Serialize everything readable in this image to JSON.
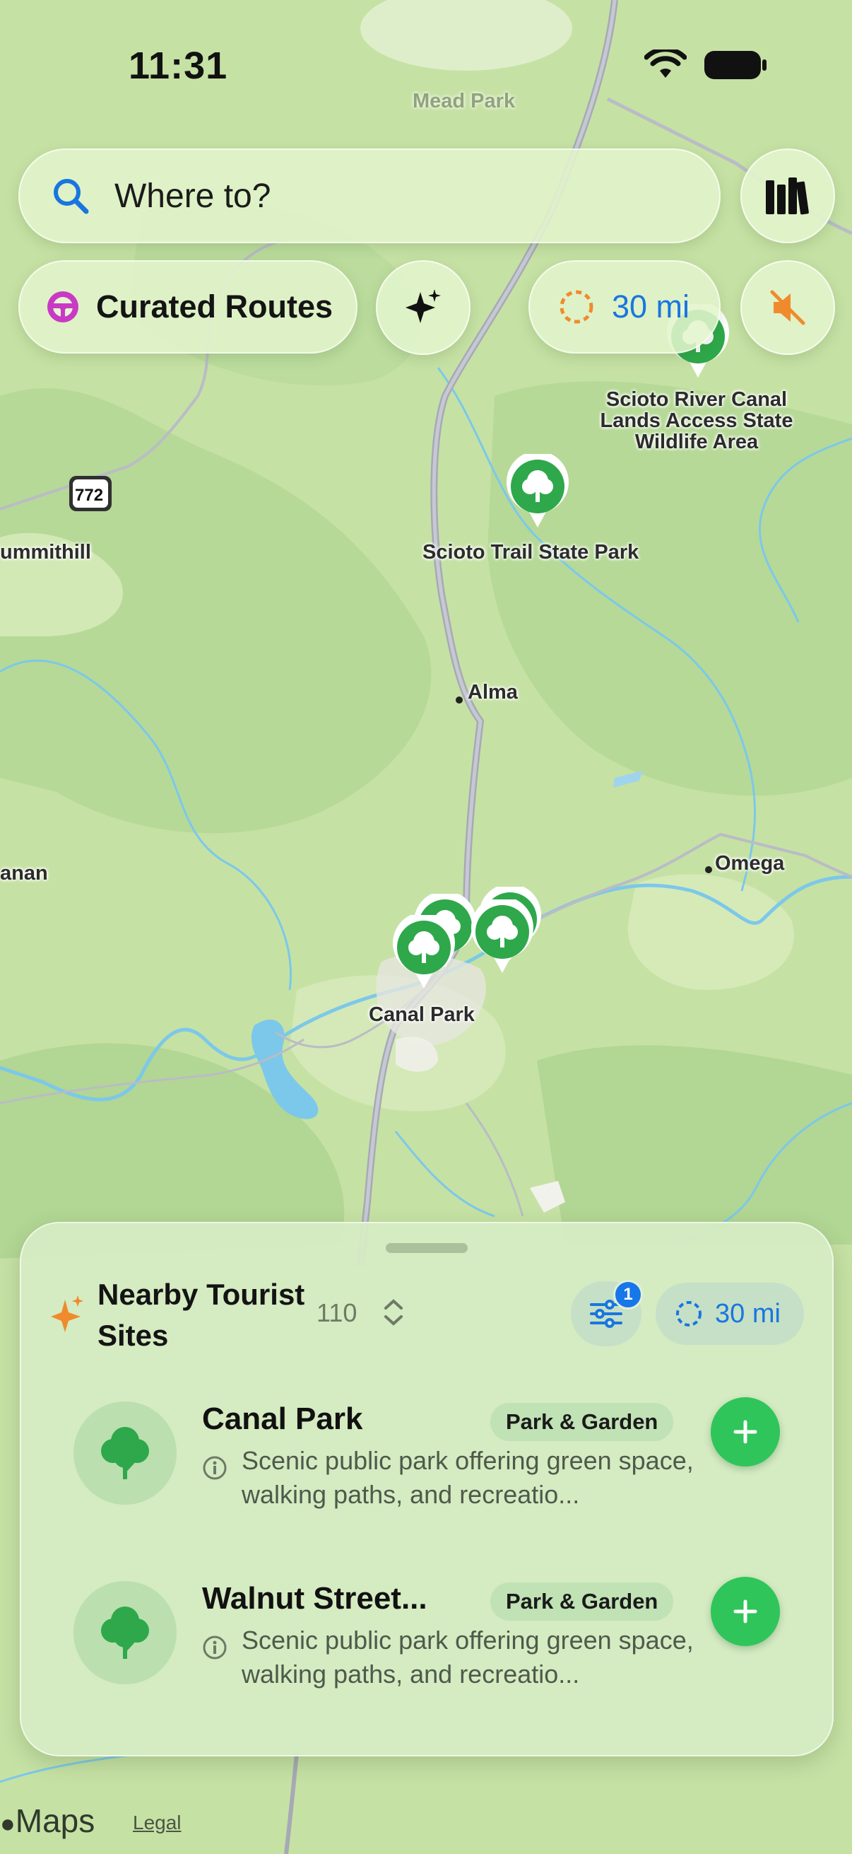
{
  "status_bar": {
    "time": "11:31"
  },
  "search": {
    "placeholder": "Where to?"
  },
  "toolbar": {
    "curated_routes_label": "Curated Routes",
    "distance_label": "30 mi"
  },
  "map": {
    "labels": {
      "scioto_canal": "Scioto River Canal Lands Access State Wildlife Area",
      "scioto_trail": "Scioto Trail State Park",
      "alma": "Alma",
      "omega": "Omega",
      "canal_park": "Canal Park",
      "summithill": "ummithill",
      "anan": "anan",
      "mead_park": "Mead Park",
      "route_number": "772"
    }
  },
  "sheet": {
    "title": "Nearby Tourist Sites",
    "count": "110",
    "filter_badge": "1",
    "distance_label": "30 mi",
    "items": [
      {
        "title": "Canal Park",
        "category": "Park & Garden",
        "description": "Scenic public park offering green space, walking paths, and recreatio..."
      },
      {
        "title": "Walnut Street...",
        "category": "Park & Garden",
        "description": "Scenic public park offering green space, walking paths, and recreatio..."
      }
    ]
  },
  "footer": {
    "maps_label": "Maps",
    "legal_label": "Legal"
  },
  "colors": {
    "accent_blue": "#1976e0",
    "add_green": "#2fc55a",
    "pin_green": "#2ea84a",
    "map_green": "#c9e3a8"
  }
}
